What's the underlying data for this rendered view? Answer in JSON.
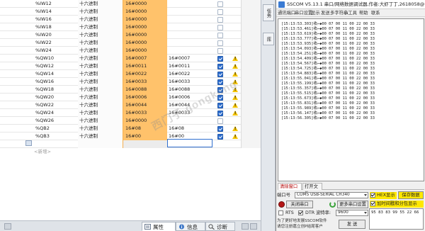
{
  "watch_table": {
    "rows": [
      {
        "name": "%IW12",
        "format": "十六进制",
        "monitor": "16#0000",
        "modify": "",
        "checked": false,
        "warning": false
      },
      {
        "name": "%IW14",
        "format": "十六进制",
        "monitor": "16#0000",
        "modify": "",
        "checked": false,
        "warning": false
      },
      {
        "name": "%IW16",
        "format": "十六进制",
        "monitor": "16#0000",
        "modify": "",
        "checked": false,
        "warning": false
      },
      {
        "name": "%IW18",
        "format": "十六进制",
        "monitor": "16#0000",
        "modify": "",
        "checked": false,
        "warning": false
      },
      {
        "name": "%IW20",
        "format": "十六进制",
        "monitor": "16#0000",
        "modify": "",
        "checked": false,
        "warning": false
      },
      {
        "name": "%IW22",
        "format": "十六进制",
        "monitor": "16#0000",
        "modify": "",
        "checked": false,
        "warning": false
      },
      {
        "name": "%IW24",
        "format": "十六进制",
        "monitor": "16#0000",
        "modify": "",
        "checked": false,
        "warning": false
      },
      {
        "name": "%QW10",
        "format": "十六进制",
        "monitor": "16#0007",
        "modify": "16#0007",
        "checked": true,
        "warning": true
      },
      {
        "name": "%QW12",
        "format": "十六进制",
        "monitor": "16#0011",
        "modify": "16#0011",
        "checked": true,
        "warning": true
      },
      {
        "name": "%QW14",
        "format": "十六进制",
        "monitor": "16#0022",
        "modify": "16#0022",
        "checked": true,
        "warning": true
      },
      {
        "name": "%QW16",
        "format": "十六进制",
        "monitor": "16#0033",
        "modify": "16#0033",
        "checked": true,
        "warning": true
      },
      {
        "name": "%QW18",
        "format": "十六进制",
        "monitor": "16#0088",
        "modify": "16#0088",
        "checked": true,
        "warning": true
      },
      {
        "name": "%QW20",
        "format": "十六进制",
        "monitor": "16#0006",
        "modify": "16#0006",
        "checked": true,
        "warning": true
      },
      {
        "name": "%QW22",
        "format": "十六进制",
        "monitor": "16#0044",
        "modify": "16#0044",
        "checked": true,
        "warning": true
      },
      {
        "name": "%QW24",
        "format": "十六进制",
        "monitor": "16#0033",
        "modify": "16#0033",
        "checked": true,
        "warning": true
      },
      {
        "name": "%QW26",
        "format": "十六进制",
        "monitor": "16#0000",
        "modify": "",
        "checked": false,
        "warning": false
      },
      {
        "name": "%QB2",
        "format": "十六进制",
        "monitor": "16#08",
        "modify": "16#08",
        "checked": true,
        "warning": true
      },
      {
        "name": "%QB3",
        "format": "十六进制",
        "monitor": "16#00",
        "modify": "16#00",
        "checked": true,
        "warning": true
      }
    ],
    "add_row": "<新增>",
    "watermark": "西门子 gongkong"
  },
  "bottom_tabs": {
    "properties": "属性",
    "info": "信息",
    "diagnostics": "诊断"
  },
  "side_tabs": [
    "任务",
    "库"
  ],
  "sscom": {
    "title": "SSCOM V5.13.1 串口/网络数据调试器,作者:大虾丁丁,2618058@",
    "menu": [
      "通讯端口",
      "串口设置",
      "显示",
      "发送",
      "多字符串",
      "小工具",
      "帮助",
      "联系"
    ],
    "log": [
      "[15:13:53.303]收←◆00 07 00 11 00 22 00 33",
      "[15:13:53.461]收←◆00 07 00 11 00 22 00 33",
      "[15:13:53.619]收←◆00 07 00 11 00 22 00 33",
      "[15:13:53.777]收←◆00 07 00 11 00 22 00 33",
      "[15:13:53.935]收←◆00 07 00 11 00 22 00 33",
      "[15:13:54.093]收←◆00 07 00 11 00 22 00 33",
      "[15:13:54.251]收←◆00 07 00 11 00 22 00 33",
      "[15:13:54.409]收←◆00 07 00 11 00 22 00 33",
      "[15:13:54.567]收←◆00 07 00 11 00 22 00 33",
      "[15:13:54.725]收←◆00 07 00 11 00 22 00 33",
      "[15:13:54.883]收←◆00 07 00 11 00 22 00 33",
      "[15:13:55.041]收←◆00 07 00 11 00 22 00 33",
      "[15:13:55.199]收←◆00 07 00 11 00 22 00 33",
      "[15:13:55.357]收←◆00 07 00 11 00 22 00 33",
      "[15:13:55.515]收←◆00 07 00 11 00 22 00 33",
      "[15:13:55.673]收←◆00 07 00 11 00 22 00 33",
      "[15:13:55.831]收←◆00 07 00 11 00 22 00 33",
      "[15:13:55.989]收←◆00 07 00 11 00 22 00 33",
      "[15:13:56.147]收←◆00 07 00 11 00 22 00 33",
      "[15:13:56.305]收←◆00 07 00 11 00 22 00 33"
    ],
    "tab_clear": "清除窗口",
    "tab_open": "打开文件",
    "port_label": "端口号",
    "port_value": "COM5 USB-SERIAL CH340",
    "hex_display": "HEX显示",
    "save_data": "保存数据",
    "timestamp_label": "加时间戳和分包显示",
    "close_port": "关闭串口",
    "more_settings": "更多串口设置",
    "rts": "RTS",
    "dtr": "DTR",
    "baud_label": "波特率:",
    "baud_value": "9600",
    "send_data": "95 83 83 99 55 22 66",
    "footer_line1": "为了更好地发展SSCOM软件",
    "footer_line2": "请您注册嘉立创P结尾客户",
    "send_button": "发 送"
  }
}
